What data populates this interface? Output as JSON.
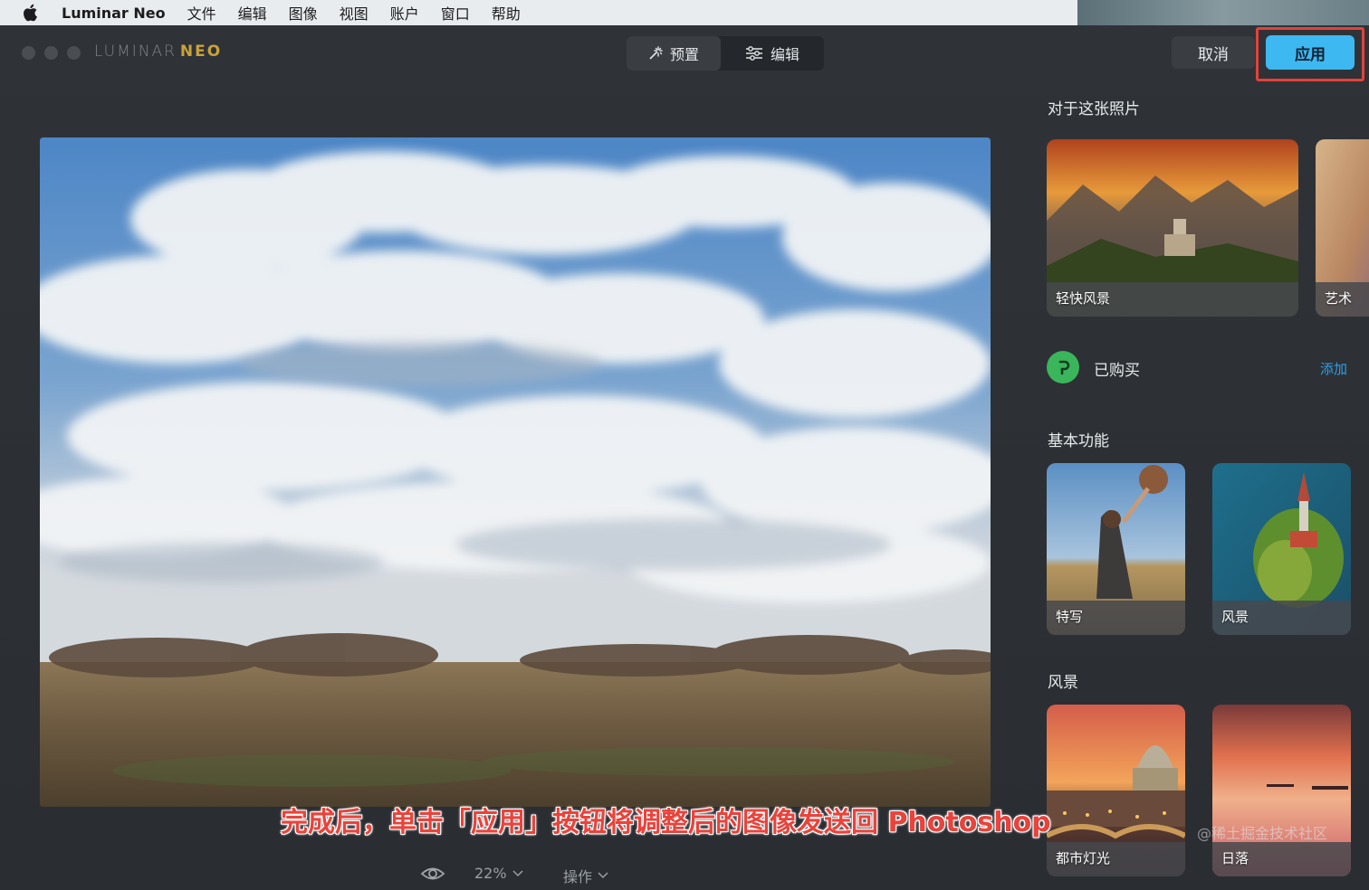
{
  "menubar": {
    "app_name": "Luminar Neo",
    "items": [
      "文件",
      "编辑",
      "图像",
      "视图",
      "账户",
      "窗口",
      "帮助"
    ]
  },
  "window": {
    "brand_main": "LUMINAR",
    "brand_accent": "NEO",
    "mode_tabs": [
      {
        "label": "预置",
        "icon": "magic-wand-icon",
        "active": true
      },
      {
        "label": "编辑",
        "icon": "sliders-icon",
        "active": false
      }
    ],
    "cancel_label": "取消",
    "apply_label": "应用"
  },
  "sidebar": {
    "for_this_photo_title": "对于这张照片",
    "for_this_photo_cards": [
      {
        "label": "轻快风景"
      },
      {
        "label": "艺术"
      }
    ],
    "purchased_label": "已购买",
    "add_label": "添加",
    "basic_title": "基本功能",
    "basic_cards": [
      {
        "label": "特写"
      },
      {
        "label": "风景"
      }
    ],
    "landscape_title": "风景",
    "landscape_cards": [
      {
        "label": "都市灯光"
      },
      {
        "label": "日落"
      }
    ]
  },
  "bottom_toolbar": {
    "zoom_label": "22%",
    "actions_label": "操作"
  },
  "annotation": {
    "caption": "完成后，单击「应用」按钮将调整后的图像发送回 Photoshop",
    "watermark": "@稀土掘金技术社区"
  },
  "colors": {
    "apply_accent": "#3db8f1",
    "highlight_border": "#e5413a",
    "purchased_green": "#3bb55c",
    "link_blue": "#2f9ee8"
  }
}
